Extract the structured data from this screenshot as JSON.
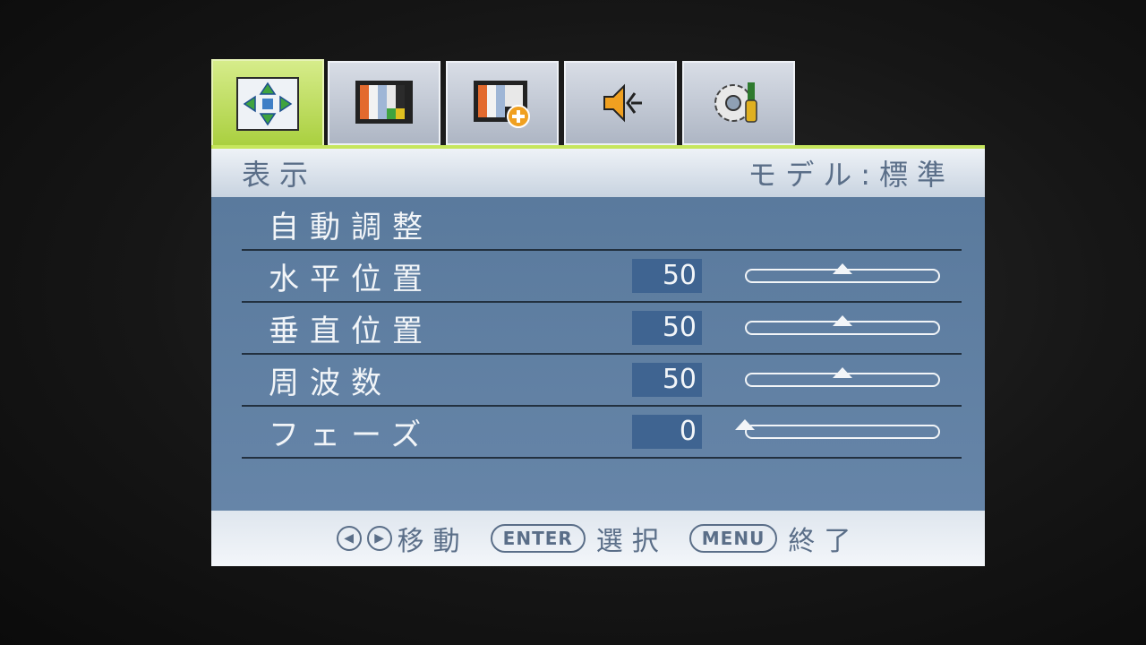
{
  "tabs": [
    {
      "icon": "move-arrows-icon",
      "active": true
    },
    {
      "icon": "picture-color-bars-icon",
      "active": false
    },
    {
      "icon": "picture-advanced-icon",
      "active": false
    },
    {
      "icon": "speaker-audio-icon",
      "active": false
    },
    {
      "icon": "gear-settings-icon",
      "active": false
    }
  ],
  "header": {
    "title": "表示",
    "mode": "モデル:標準"
  },
  "menu": {
    "items": [
      {
        "label": "自動調整"
      },
      {
        "label": "水平位置",
        "value": "50",
        "level": 0.5
      },
      {
        "label": "垂直位置",
        "value": "50",
        "level": 0.5
      },
      {
        "label": "周波数",
        "value": "50",
        "level": 0.5
      },
      {
        "label": "フェーズ",
        "value": "0",
        "level": 0.0
      }
    ]
  },
  "footer": {
    "move": "移動",
    "enter_key": "ENTER",
    "select": "選択",
    "menu_key": "MENU",
    "exit": "終了"
  },
  "colors": {
    "accent": "#a9cf3e",
    "panel": "#5d7c9f",
    "value_bg": "#3f6491"
  }
}
